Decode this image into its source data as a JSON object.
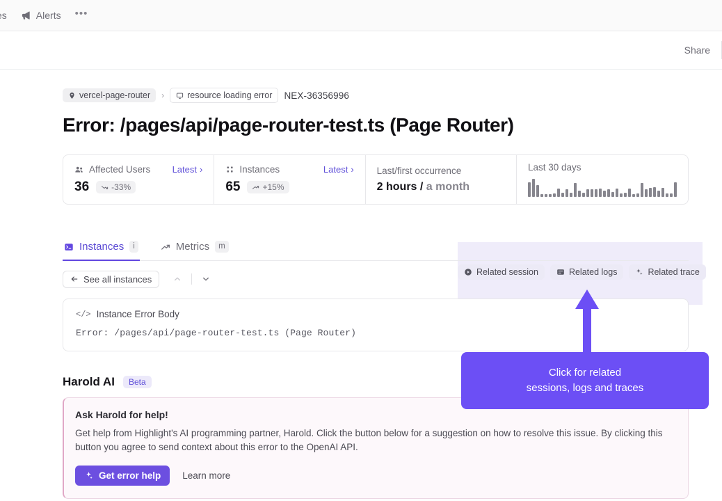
{
  "topnav": {
    "items": [
      {
        "label": "ces",
        "icon": "clipped-nav-item"
      },
      {
        "label": "Alerts",
        "icon": "megaphone-icon"
      }
    ],
    "more_label": "•••"
  },
  "subheader": {
    "share_label": "Share"
  },
  "breadcrumb": {
    "project": "vercel-page-router",
    "separator": "›",
    "error_type": "resource loading error",
    "error_id": "NEX-36356996"
  },
  "page_title": "Error: /pages/api/page-router-test.ts (Page Router)",
  "stats": [
    {
      "label": "Affected Users",
      "icon": "users-icon",
      "link": "Latest",
      "link_chevron": "›",
      "value": "36",
      "delta": "-33%",
      "delta_direction": "down"
    },
    {
      "label": "Instances",
      "icon": "grid-dots-icon",
      "link": "Latest",
      "link_chevron": "›",
      "value": "65",
      "delta": "+15%",
      "delta_direction": "up"
    },
    {
      "label": "Last/first occurrence",
      "value_strong": "2 hours /",
      "value_muted": " a month"
    },
    {
      "label": "Last 30 days",
      "sparkline": [
        18,
        22,
        14,
        3,
        3,
        3,
        4,
        10,
        5,
        9,
        5,
        17,
        8,
        5,
        9,
        9,
        9,
        10,
        8,
        9,
        6,
        10,
        4,
        5,
        10,
        3,
        4,
        17,
        9,
        11,
        12,
        8,
        11,
        4,
        4,
        18
      ]
    }
  ],
  "tabs": [
    {
      "label": "Instances",
      "shortcut": "i",
      "icon": "terminal-icon",
      "active": true
    },
    {
      "label": "Metrics",
      "shortcut": "m",
      "icon": "trend-up-icon",
      "active": false
    }
  ],
  "instances_toolbar": {
    "see_all_label": "See all instances",
    "see_all_icon": "arrow-left-icon",
    "prev_icon": "chevron-up-icon",
    "next_icon": "chevron-down-icon"
  },
  "related": [
    {
      "label": "Related session",
      "icon": "play-circle-icon"
    },
    {
      "label": "Related logs",
      "icon": "logs-icon"
    },
    {
      "label": "Related trace",
      "icon": "sparkle-icon"
    }
  ],
  "error_card": {
    "heading": "Instance Error Body",
    "heading_icon": "code-icon",
    "body": "Error: /pages/api/page-router-test.ts (Page Router)"
  },
  "harold": {
    "title": "Harold AI",
    "badge": "Beta",
    "card_heading": "Ask Harold for help!",
    "card_body": "Get help from Highlight's AI programming partner, Harold. Click the button below for a suggestion on how to resolve this issue. By clicking this button you agree to send context about this error to the OpenAI API.",
    "primary_button": "Get error help",
    "primary_button_icon": "sparkle-icon",
    "secondary_link": "Learn more"
  },
  "callout": {
    "line1": "Click for related",
    "line2": "sessions, logs and traces",
    "color": "#6c4ff5"
  },
  "colors": {
    "accent": "#6c4fe0",
    "accent_bright": "#6c4ff5",
    "link": "#6152d9",
    "muted": "#6f6e77",
    "harold_border": "#e0a8c6",
    "harold_bg": "#fdf8fb",
    "highlight_band": "#efecfa"
  }
}
